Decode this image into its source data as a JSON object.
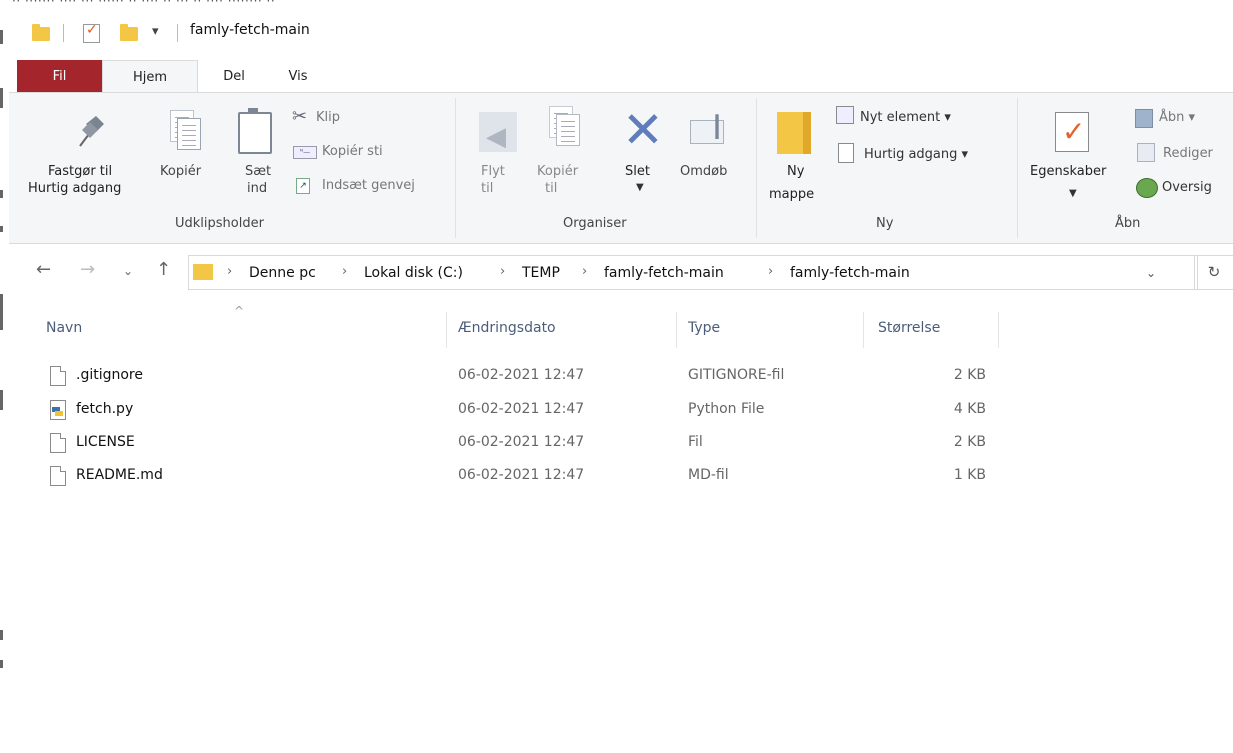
{
  "window": {
    "title": "famly-fetch-main",
    "top_fragment": "·· ······· ···· ··· ······ ··  ···· ·· ··· ·· ···· ········ ··"
  },
  "ribbon_tabs": [
    "Fil",
    "Hjem",
    "Del",
    "Vis"
  ],
  "ribbon": {
    "pin_label_1": "Fastgør til",
    "pin_label_2": "Hurtig adgang",
    "copy_label": "Kopiér",
    "paste_label_1": "Sæt",
    "paste_label_2": "ind",
    "cut_label": "Klip",
    "copy_path_label": "Kopiér sti",
    "paste_shortcut_label": "Indsæt genvej",
    "group_clipboard": "Udklipsholder",
    "move_label_1": "Flyt",
    "move_label_2": "til",
    "copyto_label_1": "Kopiér",
    "copyto_label_2": "til",
    "delete_label": "Slet",
    "rename_label": "Omdøb",
    "group_organize": "Organiser",
    "new_folder_label_1": "Ny",
    "new_folder_label_2": "mappe",
    "new_item_label": "Nyt element ▾",
    "easy_access_label": "Hurtig adgang ▾",
    "group_new": "Ny",
    "properties_label": "Egenskaber",
    "open_label": "Åbn ▾",
    "edit_label": "Rediger",
    "history_label": "Oversig",
    "group_open": "Åbn"
  },
  "address": {
    "crumbs": [
      "Denne pc",
      "Lokal disk (C:)",
      "TEMP",
      "famly-fetch-main",
      "famly-fetch-main"
    ]
  },
  "columns": {
    "name": "Navn",
    "date": "Ændringsdato",
    "type": "Type",
    "size": "Størrelse"
  },
  "files": [
    {
      "name": ".gitignore",
      "date": "06-02-2021 12:47",
      "type": "GITIGNORE-fil",
      "size": "2 KB",
      "icon": "file-icon"
    },
    {
      "name": "fetch.py",
      "date": "06-02-2021 12:47",
      "type": "Python File",
      "size": "4 KB",
      "icon": "python-file-icon"
    },
    {
      "name": "LICENSE",
      "date": "06-02-2021 12:47",
      "type": "Fil",
      "size": "2 KB",
      "icon": "file-icon"
    },
    {
      "name": "README.md",
      "date": "06-02-2021 12:47",
      "type": "MD-fil",
      "size": "1 KB",
      "icon": "file-icon"
    }
  ],
  "colors": {
    "file_tab": "#a4262c",
    "ribbon_bg": "#f5f6f7",
    "folder_yellow": "#f3c745",
    "delete_blue": "#5f7dbd"
  }
}
